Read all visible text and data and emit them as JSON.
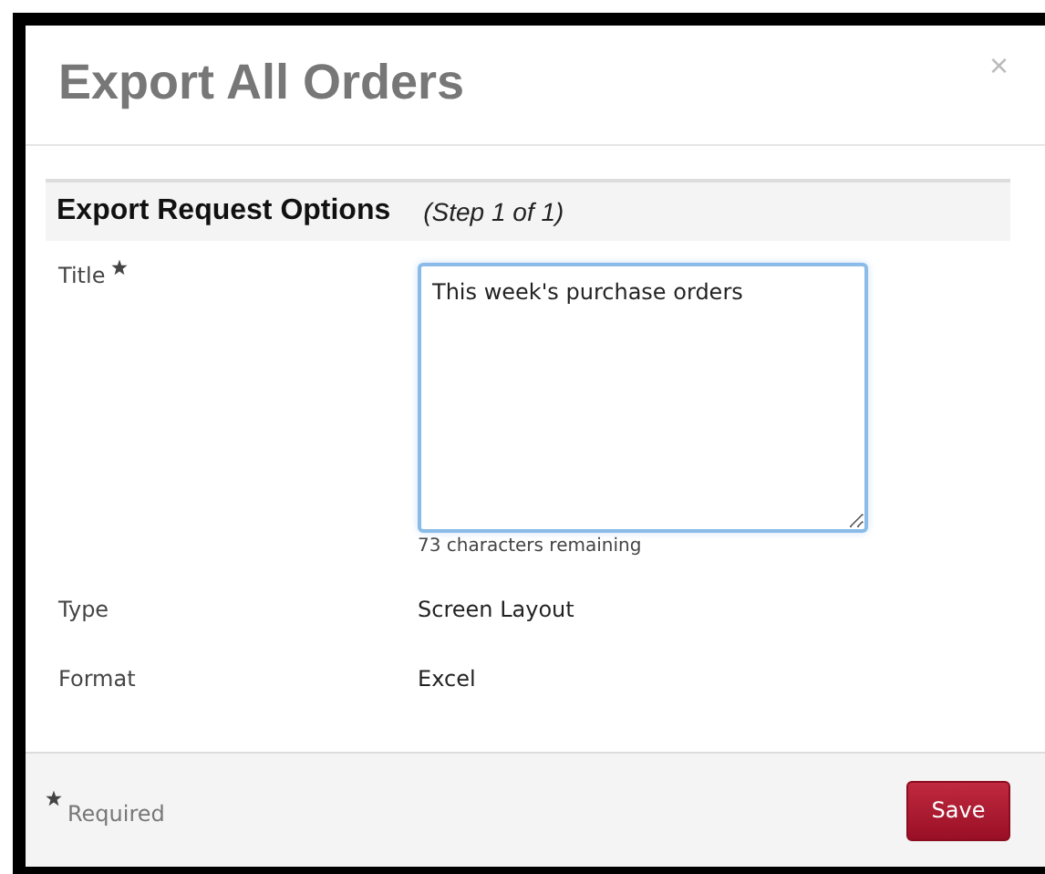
{
  "dialog": {
    "title": "Export All Orders",
    "close": "×",
    "section": {
      "title": "Export Request Options",
      "step": "(Step 1 of 1)"
    },
    "fields": [
      {
        "kind": "textarea",
        "label": "Title",
        "required": true,
        "value": "This week's purchase orders",
        "hint": "73 characters remaining"
      },
      {
        "kind": "static",
        "label": "Type",
        "required": false,
        "value": "Screen Layout"
      },
      {
        "kind": "static",
        "label": "Format",
        "required": false,
        "value": "Excel"
      }
    ],
    "footer": {
      "required_note": "Required",
      "buttons": [
        "Save"
      ]
    }
  }
}
